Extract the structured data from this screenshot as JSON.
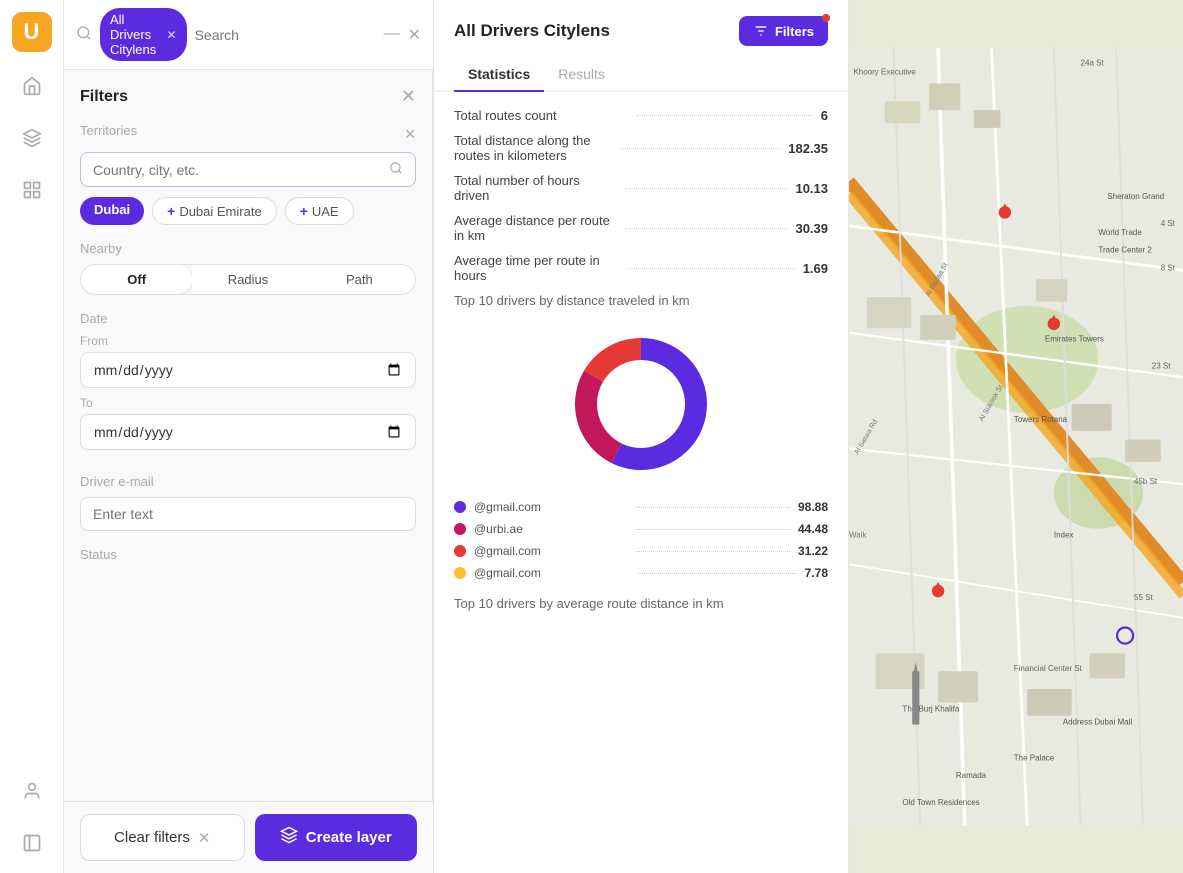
{
  "app": {
    "logo": "U",
    "search_tag": "All Drivers Citylens",
    "search_placeholder": "Search"
  },
  "filters": {
    "title": "Filters",
    "territories_label": "Territories",
    "territory_placeholder": "Country, city, etc.",
    "tags": [
      {
        "label": "Dubai",
        "active": true
      },
      {
        "label": "Dubai Emirate",
        "active": false
      },
      {
        "label": "UAE",
        "active": false
      }
    ],
    "nearby_label": "Nearby",
    "nearby_options": [
      "Off",
      "Radius",
      "Path"
    ],
    "nearby_active": "Off",
    "date_label": "Date",
    "from_label": "From",
    "to_label": "To",
    "date_from_placeholder": "mm/dd/yyyy",
    "date_to_placeholder": "mm/dd/yyyy",
    "driver_email_label": "Driver e-mail",
    "driver_email_placeholder": "Enter text",
    "status_label": "Status",
    "clear_filters_label": "Clear filters",
    "create_layer_label": "Create layer"
  },
  "stats": {
    "title": "All Drivers Citylens",
    "filters_btn": "Filters",
    "tabs": [
      "Statistics",
      "Results"
    ],
    "active_tab": "Statistics",
    "metrics": [
      {
        "label": "Total routes count",
        "value": "6"
      },
      {
        "label": "Total distance along the routes in kilometers",
        "value": "182.35"
      },
      {
        "label": "Total number of hours driven",
        "value": "10.13"
      },
      {
        "label": "Average distance per route in km",
        "value": "30.39"
      },
      {
        "label": "Average time per route in hours",
        "value": "1.69"
      }
    ],
    "chart_title": "Top 10 drivers by distance traveled in km",
    "chart_data": [
      {
        "label": "@gmail.com",
        "value": "98.88",
        "color": "#5b2be0",
        "percentage": 53
      },
      {
        "label": "@urbi.ae",
        "value": "44.48",
        "color": "#c2185b",
        "percentage": 24
      },
      {
        "label": "@gmail.com",
        "value": "31.22",
        "color": "#e53935",
        "percentage": 17
      },
      {
        "label": "@gmail.com",
        "value": "7.78",
        "color": "#fbc02d",
        "percentage": 4
      }
    ],
    "chart2_title": "Top 10 drivers by average route distance in km"
  }
}
